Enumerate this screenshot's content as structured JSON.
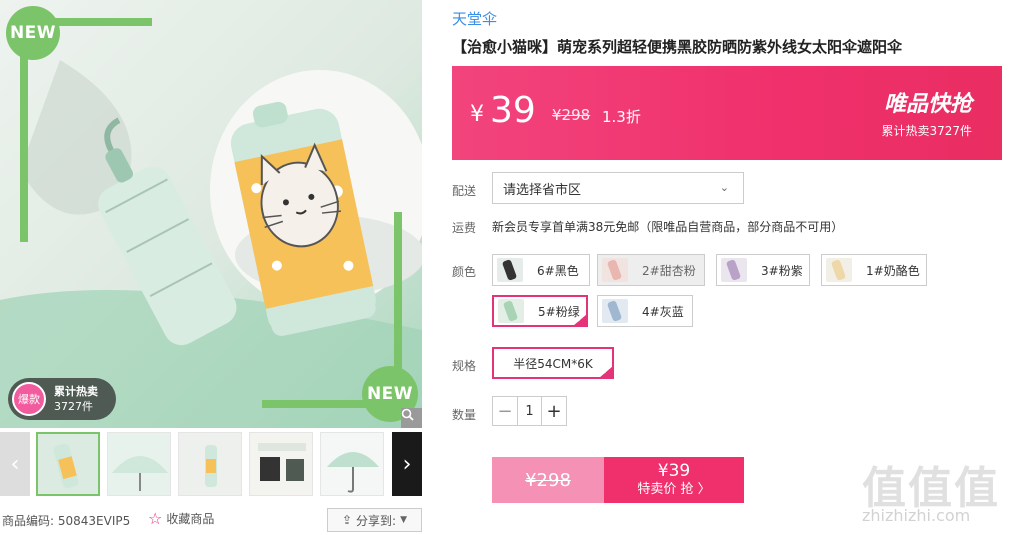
{
  "gallery": {
    "new_badge_top": "NEW",
    "new_badge_bottom": "NEW",
    "hot_circle": "爆款",
    "hot_title": "累计热卖",
    "hot_count": "3727件",
    "zoom_icon": "magnifier-icon",
    "prev_icon": "chevron-left-icon",
    "next_icon": "chevron-right-icon"
  },
  "meta": {
    "code_label": "商品编码:",
    "code_value": "50843EVIP5",
    "favorite_label": "收藏商品",
    "favorite_icon": "star-outline-icon",
    "share_label": "分享到:",
    "share_icon": "share-icon"
  },
  "product": {
    "brand": "天堂伞",
    "title": "【治愈小猫咪】萌宠系列超轻便携黑胶防晒防紫外线女太阳伞遮阳伞"
  },
  "price_banner": {
    "currency": "¥",
    "price": "39",
    "original": "¥298",
    "discount": "1.3折",
    "flash_label": "唯品快抢",
    "sold": "累计热卖3727件",
    "color": "#f0306c"
  },
  "delivery": {
    "label": "配送",
    "placeholder": "请选择省市区",
    "chevron_icon": "chevron-down-icon"
  },
  "shipping": {
    "label": "运费",
    "text": "新会员专享首单满38元免邮（限唯品自营商品，部分商品不可用）"
  },
  "colors": {
    "label": "颜色",
    "options": [
      {
        "label": "6#黑色",
        "state": "normal"
      },
      {
        "label": "2#甜杏粉",
        "state": "disabled"
      },
      {
        "label": "3#粉紫",
        "state": "normal"
      },
      {
        "label": "1#奶酪色",
        "state": "normal"
      },
      {
        "label": "5#粉绿",
        "state": "selected"
      },
      {
        "label": "4#灰蓝",
        "state": "normal"
      }
    ]
  },
  "size": {
    "label": "规格",
    "option": "半径54CM*6K",
    "state": "selected"
  },
  "quantity": {
    "label": "数量",
    "minus": "−",
    "value": "1",
    "plus": "+"
  },
  "buy": {
    "original": "¥298",
    "price": "¥39",
    "cta": "特卖价 抢 〉"
  },
  "watermark": {
    "logo": "值值值",
    "url": "zhizhizhi.com"
  }
}
